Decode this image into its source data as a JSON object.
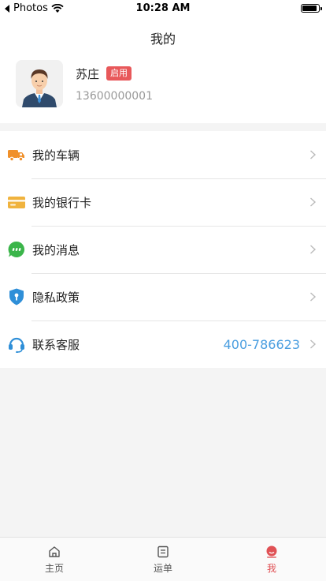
{
  "status_bar": {
    "back_app": "Photos",
    "time": "10:28 AM"
  },
  "header": {
    "title": "我的"
  },
  "profile": {
    "name": "苏庄",
    "status": "启用",
    "phone": "13600000001"
  },
  "menu": {
    "items": [
      {
        "label": "我的车辆",
        "icon": "truck-icon"
      },
      {
        "label": "我的银行卡",
        "icon": "bank-card-icon"
      },
      {
        "label": "我的消息",
        "icon": "message-icon"
      },
      {
        "label": "隐私政策",
        "icon": "shield-icon"
      },
      {
        "label": "联系客服",
        "icon": "headset-icon",
        "value": "400-786623"
      }
    ]
  },
  "tabs": [
    {
      "label": "主页",
      "icon": "home-icon"
    },
    {
      "label": "运单",
      "icon": "waybill-icon"
    },
    {
      "label": "我",
      "icon": "profile-icon",
      "active": true
    }
  ],
  "colors": {
    "accent_red": "#e05155",
    "link_blue": "#4a9ee0",
    "truck": "#f0902a",
    "card": "#f0b33e",
    "message": "#3bb54a",
    "shield": "#2f8fd8",
    "headset": "#2f8fd8"
  }
}
